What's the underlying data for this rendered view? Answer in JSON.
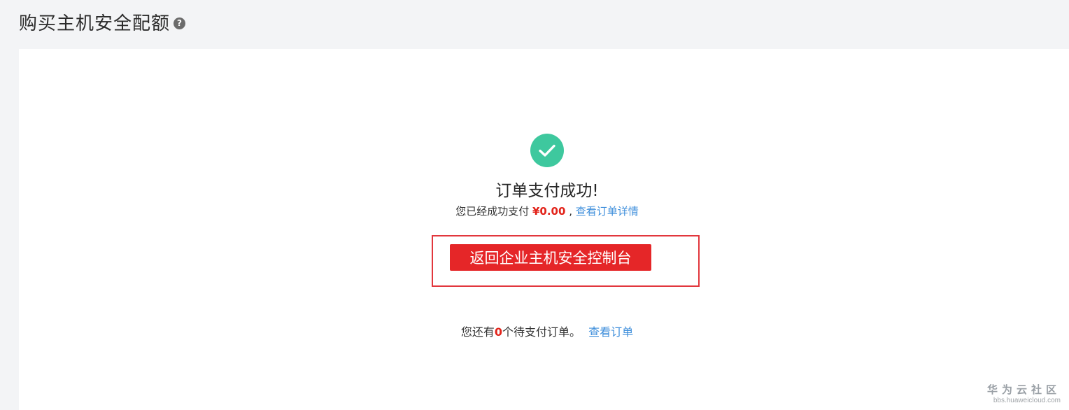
{
  "header": {
    "title": "购买主机安全配额",
    "help_icon": "question-circle-icon",
    "help_glyph": "?"
  },
  "result": {
    "status_icon": "check-circle-icon",
    "status_color": "#3ec89e",
    "title": "订单支付成功!",
    "paid_prefix": "您已经成功支付",
    "amount": "¥0.00",
    "separator": ",",
    "view_order_detail_link": "查看订单详情",
    "return_button_label": "返回企业主机安全控制台",
    "accent_color": "#e52628"
  },
  "pending": {
    "prefix": "您还有",
    "count": "0",
    "suffix": "个待支付订单。",
    "view_orders_link": "查看订单"
  },
  "watermark": {
    "title": "华为云社区",
    "url": "bbs.huaweicloud.com"
  }
}
